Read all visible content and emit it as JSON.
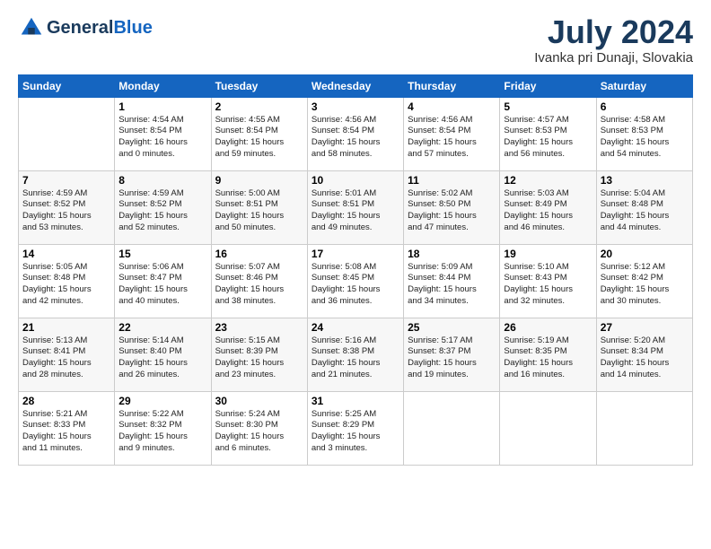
{
  "header": {
    "logo_line1": "General",
    "logo_line2": "Blue",
    "month": "July 2024",
    "location": "Ivanka pri Dunaji, Slovakia"
  },
  "days_of_week": [
    "Sunday",
    "Monday",
    "Tuesday",
    "Wednesday",
    "Thursday",
    "Friday",
    "Saturday"
  ],
  "weeks": [
    [
      {
        "day": "",
        "info": ""
      },
      {
        "day": "1",
        "info": "Sunrise: 4:54 AM\nSunset: 8:54 PM\nDaylight: 16 hours\nand 0 minutes."
      },
      {
        "day": "2",
        "info": "Sunrise: 4:55 AM\nSunset: 8:54 PM\nDaylight: 15 hours\nand 59 minutes."
      },
      {
        "day": "3",
        "info": "Sunrise: 4:56 AM\nSunset: 8:54 PM\nDaylight: 15 hours\nand 58 minutes."
      },
      {
        "day": "4",
        "info": "Sunrise: 4:56 AM\nSunset: 8:54 PM\nDaylight: 15 hours\nand 57 minutes."
      },
      {
        "day": "5",
        "info": "Sunrise: 4:57 AM\nSunset: 8:53 PM\nDaylight: 15 hours\nand 56 minutes."
      },
      {
        "day": "6",
        "info": "Sunrise: 4:58 AM\nSunset: 8:53 PM\nDaylight: 15 hours\nand 54 minutes."
      }
    ],
    [
      {
        "day": "7",
        "info": "Sunrise: 4:59 AM\nSunset: 8:52 PM\nDaylight: 15 hours\nand 53 minutes."
      },
      {
        "day": "8",
        "info": "Sunrise: 4:59 AM\nSunset: 8:52 PM\nDaylight: 15 hours\nand 52 minutes."
      },
      {
        "day": "9",
        "info": "Sunrise: 5:00 AM\nSunset: 8:51 PM\nDaylight: 15 hours\nand 50 minutes."
      },
      {
        "day": "10",
        "info": "Sunrise: 5:01 AM\nSunset: 8:51 PM\nDaylight: 15 hours\nand 49 minutes."
      },
      {
        "day": "11",
        "info": "Sunrise: 5:02 AM\nSunset: 8:50 PM\nDaylight: 15 hours\nand 47 minutes."
      },
      {
        "day": "12",
        "info": "Sunrise: 5:03 AM\nSunset: 8:49 PM\nDaylight: 15 hours\nand 46 minutes."
      },
      {
        "day": "13",
        "info": "Sunrise: 5:04 AM\nSunset: 8:48 PM\nDaylight: 15 hours\nand 44 minutes."
      }
    ],
    [
      {
        "day": "14",
        "info": "Sunrise: 5:05 AM\nSunset: 8:48 PM\nDaylight: 15 hours\nand 42 minutes."
      },
      {
        "day": "15",
        "info": "Sunrise: 5:06 AM\nSunset: 8:47 PM\nDaylight: 15 hours\nand 40 minutes."
      },
      {
        "day": "16",
        "info": "Sunrise: 5:07 AM\nSunset: 8:46 PM\nDaylight: 15 hours\nand 38 minutes."
      },
      {
        "day": "17",
        "info": "Sunrise: 5:08 AM\nSunset: 8:45 PM\nDaylight: 15 hours\nand 36 minutes."
      },
      {
        "day": "18",
        "info": "Sunrise: 5:09 AM\nSunset: 8:44 PM\nDaylight: 15 hours\nand 34 minutes."
      },
      {
        "day": "19",
        "info": "Sunrise: 5:10 AM\nSunset: 8:43 PM\nDaylight: 15 hours\nand 32 minutes."
      },
      {
        "day": "20",
        "info": "Sunrise: 5:12 AM\nSunset: 8:42 PM\nDaylight: 15 hours\nand 30 minutes."
      }
    ],
    [
      {
        "day": "21",
        "info": "Sunrise: 5:13 AM\nSunset: 8:41 PM\nDaylight: 15 hours\nand 28 minutes."
      },
      {
        "day": "22",
        "info": "Sunrise: 5:14 AM\nSunset: 8:40 PM\nDaylight: 15 hours\nand 26 minutes."
      },
      {
        "day": "23",
        "info": "Sunrise: 5:15 AM\nSunset: 8:39 PM\nDaylight: 15 hours\nand 23 minutes."
      },
      {
        "day": "24",
        "info": "Sunrise: 5:16 AM\nSunset: 8:38 PM\nDaylight: 15 hours\nand 21 minutes."
      },
      {
        "day": "25",
        "info": "Sunrise: 5:17 AM\nSunset: 8:37 PM\nDaylight: 15 hours\nand 19 minutes."
      },
      {
        "day": "26",
        "info": "Sunrise: 5:19 AM\nSunset: 8:35 PM\nDaylight: 15 hours\nand 16 minutes."
      },
      {
        "day": "27",
        "info": "Sunrise: 5:20 AM\nSunset: 8:34 PM\nDaylight: 15 hours\nand 14 minutes."
      }
    ],
    [
      {
        "day": "28",
        "info": "Sunrise: 5:21 AM\nSunset: 8:33 PM\nDaylight: 15 hours\nand 11 minutes."
      },
      {
        "day": "29",
        "info": "Sunrise: 5:22 AM\nSunset: 8:32 PM\nDaylight: 15 hours\nand 9 minutes."
      },
      {
        "day": "30",
        "info": "Sunrise: 5:24 AM\nSunset: 8:30 PM\nDaylight: 15 hours\nand 6 minutes."
      },
      {
        "day": "31",
        "info": "Sunrise: 5:25 AM\nSunset: 8:29 PM\nDaylight: 15 hours\nand 3 minutes."
      },
      {
        "day": "",
        "info": ""
      },
      {
        "day": "",
        "info": ""
      },
      {
        "day": "",
        "info": ""
      }
    ]
  ]
}
